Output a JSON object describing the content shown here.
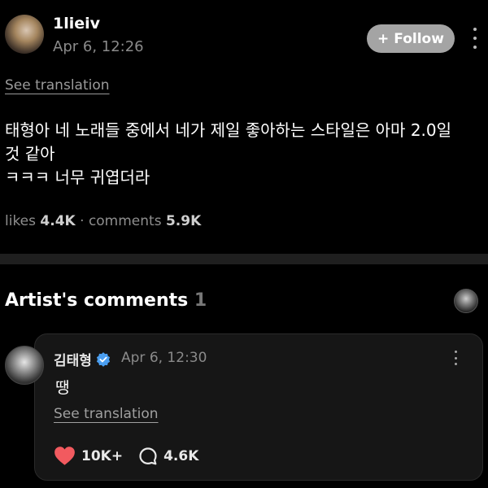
{
  "post": {
    "username": "1lieiv",
    "time": "Apr 6, 12:26",
    "follow_label": "Follow",
    "follow_plus": "+",
    "see_translation": "See translation",
    "body_lines": [
      "태형아 네 노래들 중에서 네가 제일 좋아하는 스타일은 아마 2.0일",
      "것 같아",
      "ㅋㅋㅋ 너무 귀엽더라"
    ],
    "likes_label": "likes",
    "likes_value": "4.4K",
    "stats_separator": "·",
    "comments_label": "comments",
    "comments_value": "5.9K"
  },
  "artist_comments": {
    "title": "Artist's comments",
    "count": "1",
    "comment": {
      "username": "김태형",
      "time": "Apr 6, 12:30",
      "text": "땡",
      "see_translation": "See translation",
      "likes": "10K+",
      "replies": "4.6K"
    }
  },
  "colors": {
    "background": "#000000",
    "follow_button": "#a4a4a4",
    "heart": "#f25a5f",
    "verified": "#4a9ef0",
    "card": "#161616"
  },
  "icons": [
    "more-vertical-icon",
    "plus-icon",
    "verified-badge-icon",
    "heart-icon",
    "comment-bubble-icon"
  ]
}
